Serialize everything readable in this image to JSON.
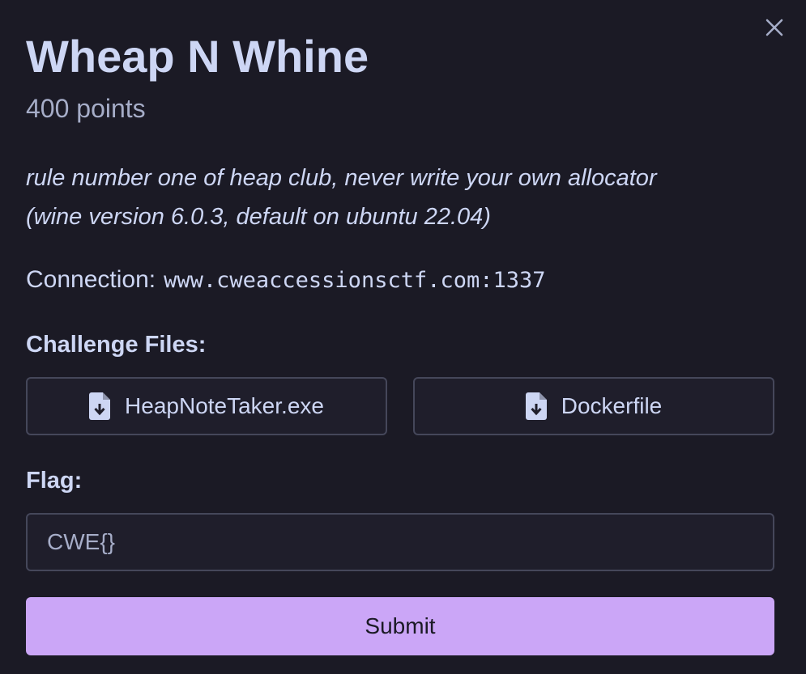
{
  "modal": {
    "close_icon": "close-icon",
    "title": "Wheap N Whine",
    "points": "400 points",
    "description": [
      "rule number one of heap club, never write your own allocator",
      "(wine version 6.0.3, default on ubuntu 22.04)"
    ],
    "connection": {
      "label": "Connection:",
      "value": "www.cweaccessionsctf.com:1337"
    },
    "files_label": "Challenge Files:",
    "files": [
      {
        "name": "HeapNoteTaker.exe",
        "icon": "file-download-icon"
      },
      {
        "name": "Dockerfile",
        "icon": "file-download-icon"
      }
    ],
    "flag_label": "Flag:",
    "flag_input": {
      "value": "",
      "placeholder": "CWE{}"
    },
    "submit_label": "Submit"
  },
  "colors": {
    "background": "#1b1a25",
    "text": "#cdd6f4",
    "muted": "#a6adc8",
    "border": "#45475a",
    "accent": "#cba6f7"
  }
}
